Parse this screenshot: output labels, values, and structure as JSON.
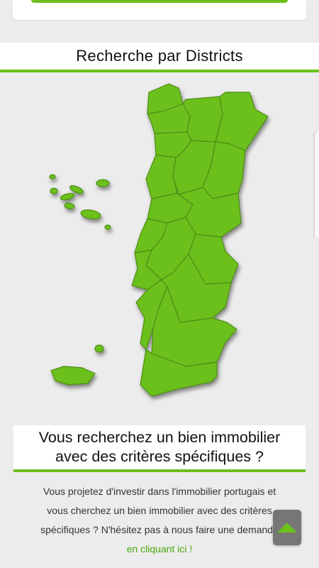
{
  "section": {
    "title": "Recherche par Districts"
  },
  "map": {
    "accent_color": "#6cc01d",
    "districts": [
      "viana-do-castelo",
      "braga",
      "vila-real",
      "braganca",
      "porto",
      "aveiro",
      "viseu",
      "guarda",
      "coimbra",
      "castelo-branco",
      "leiria",
      "santarem",
      "portalegre",
      "lisboa",
      "setubal",
      "evora",
      "beja",
      "faro"
    ],
    "islands": [
      "azores",
      "madeira"
    ]
  },
  "promo": {
    "title_line1": "Vous recherchez un bien immobilier",
    "title_line2": "avec des critères spécifiques ?"
  },
  "description": {
    "line1": "Vous projetez d'investir dans l'immobilier portugais et",
    "line2": "vous cherchez un bien immobilier avec des critères",
    "line3": "spécifiques ? N'hésitez pas à nous faire une demande",
    "link_text": "en cliquant ici !"
  },
  "colors": {
    "accent": "#6cc01d",
    "link": "#4aaa11",
    "button_bg": "#767676"
  }
}
